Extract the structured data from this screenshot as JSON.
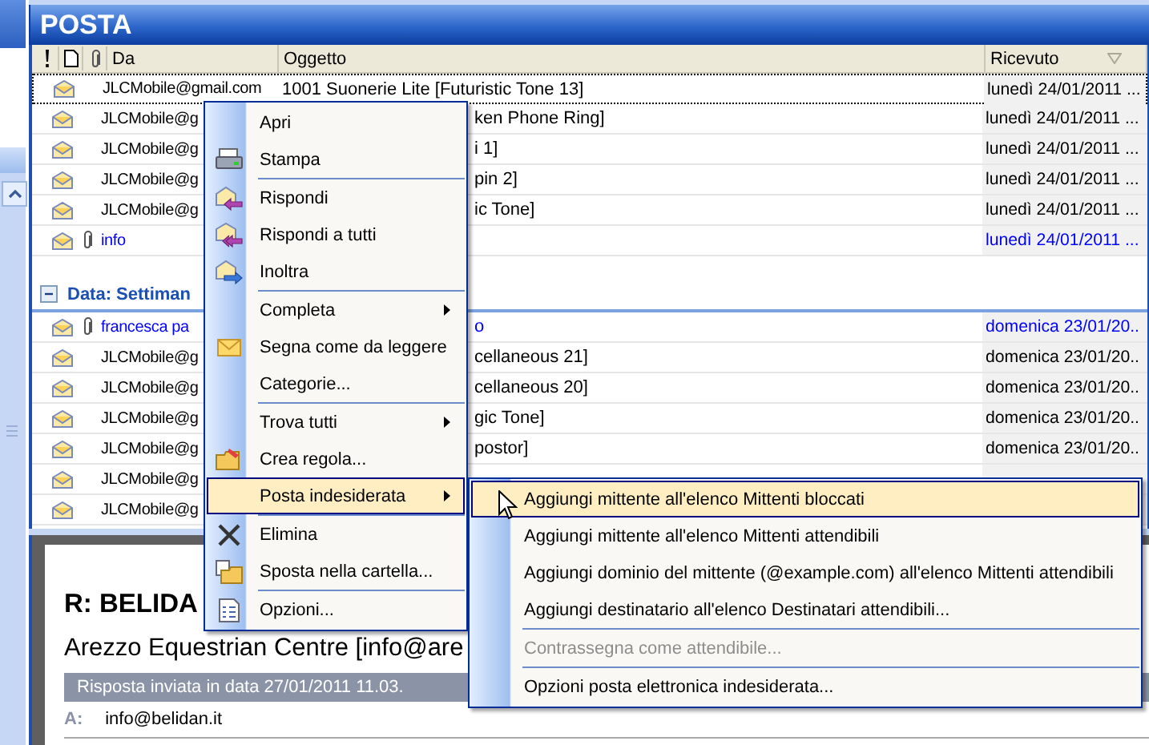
{
  "folder_title": "POSTA",
  "columns": [
    {
      "label": "Da",
      "sorted": false
    },
    {
      "label": "Oggetto",
      "sorted": false
    },
    {
      "label": "Ricevuto",
      "sorted": true
    }
  ],
  "messages": [
    {
      "from": "JLCMobile@gmail.com",
      "subject": "1001 Suonerie Lite [Futuristic Tone 13]",
      "received": "lunedì 24/01/2011 ...",
      "attachment": false,
      "focused": true,
      "color": "#000000"
    },
    {
      "from": "JLCMobile@g",
      "subject": "ken Phone Ring]",
      "received": "lunedì 24/01/2011 ...",
      "attachment": false,
      "focused": false,
      "color": "#000000"
    },
    {
      "from": "JLCMobile@g",
      "subject": "i 1]",
      "received": "lunedì 24/01/2011 ...",
      "attachment": false,
      "focused": false,
      "color": "#000000"
    },
    {
      "from": "JLCMobile@g",
      "subject": "pin 2]",
      "received": "lunedì 24/01/2011 ...",
      "attachment": false,
      "focused": false,
      "color": "#000000"
    },
    {
      "from": "JLCMobile@g",
      "subject": "ic Tone]",
      "received": "lunedì 24/01/2011 ...",
      "attachment": false,
      "focused": false,
      "color": "#000000"
    },
    {
      "from": "info",
      "received": "lunedì 24/01/2011 ...",
      "attachment": true,
      "focused": false,
      "color": "#0000ff"
    }
  ],
  "group": {
    "label": "Data: Settiman",
    "expanded": true,
    "messages": [
      {
        "from": "francesca pa",
        "subject": "o",
        "received": "domenica 23/01/20..",
        "attachment": true,
        "focused": false,
        "color": "#0000ff"
      },
      {
        "from": "JLCMobile@g",
        "subject": "cellaneous 21]",
        "received": "domenica 23/01/20..",
        "attachment": false,
        "focused": false,
        "color": "#000000"
      },
      {
        "from": "JLCMobile@g",
        "subject": "cellaneous 20]",
        "received": "domenica 23/01/20..",
        "attachment": false,
        "focused": false,
        "color": "#000000"
      },
      {
        "from": "JLCMobile@g",
        "subject": "gic Tone]",
        "received": "domenica 23/01/20..",
        "attachment": false,
        "focused": false,
        "color": "#000000"
      },
      {
        "from": "JLCMobile@g",
        "subject": "postor]",
        "received": "domenica 23/01/20..",
        "attachment": false,
        "focused": false,
        "color": "#000000"
      },
      {
        "from": "JLCMobile@g",
        "attachment": false,
        "focused": false,
        "color": "#000000"
      },
      {
        "from": "JLCMobile@g",
        "attachment": false,
        "focused": false,
        "color": "#000000"
      }
    ]
  },
  "reading_pane": {
    "subject": "R: BELIDA",
    "sender": "Arezzo Equestrian Centre [info@are",
    "info_bar": "Risposta inviata in data 27/01/2011 11.03.",
    "to_label": "A:",
    "to": "info@belidan.it"
  },
  "context_menu": {
    "items": [
      {
        "kind": "item",
        "label": "Apri",
        "submenu": false,
        "selected": false
      },
      {
        "kind": "item",
        "label": "Stampa",
        "submenu": false,
        "selected": false
      },
      {
        "kind": "separator"
      },
      {
        "kind": "item",
        "label": "Rispondi",
        "submenu": false,
        "selected": false
      },
      {
        "kind": "item",
        "label": "Rispondi a tutti",
        "submenu": false,
        "selected": false
      },
      {
        "kind": "item",
        "label": "Inoltra",
        "submenu": false,
        "selected": false
      },
      {
        "kind": "separator"
      },
      {
        "kind": "item",
        "label": "Completa",
        "submenu": true,
        "selected": false
      },
      {
        "kind": "item",
        "label": "Segna come da leggere",
        "submenu": false,
        "selected": false
      },
      {
        "kind": "item",
        "label": "Categorie...",
        "submenu": false,
        "selected": false
      },
      {
        "kind": "separator"
      },
      {
        "kind": "item",
        "label": "Trova tutti",
        "submenu": true,
        "selected": false
      },
      {
        "kind": "item",
        "label": "Crea regola...",
        "submenu": false,
        "selected": false
      },
      {
        "kind": "item",
        "label": "Posta indesiderata",
        "submenu": true,
        "selected": true
      },
      {
        "kind": "separator"
      },
      {
        "kind": "item",
        "label": "Elimina",
        "submenu": false,
        "selected": false
      },
      {
        "kind": "item",
        "label": "Sposta nella cartella...",
        "submenu": false,
        "selected": false
      },
      {
        "kind": "separator"
      },
      {
        "kind": "item",
        "label": "Opzioni...",
        "submenu": false,
        "selected": false
      }
    ]
  },
  "submenu": {
    "items": [
      {
        "kind": "item",
        "label": "Aggiungi mittente all'elenco Mittenti bloccati",
        "selected": true,
        "disabled": false
      },
      {
        "kind": "item",
        "label": "Aggiungi mittente all'elenco Mittenti attendibili",
        "selected": false,
        "disabled": false
      },
      {
        "kind": "item",
        "label": "Aggiungi dominio del mittente (@example.com) all'elenco Mittenti attendibili",
        "selected": false,
        "disabled": false
      },
      {
        "kind": "item",
        "label": "Aggiungi destinatario all'elenco Destinatari attendibili...",
        "selected": false,
        "disabled": false
      },
      {
        "kind": "separator"
      },
      {
        "kind": "item",
        "label": "Contrassegna come attendibile...",
        "selected": false,
        "disabled": true
      },
      {
        "kind": "separator"
      },
      {
        "kind": "item",
        "label": "Opzioni posta elettronica indesiderata...",
        "selected": false,
        "disabled": false
      }
    ]
  }
}
